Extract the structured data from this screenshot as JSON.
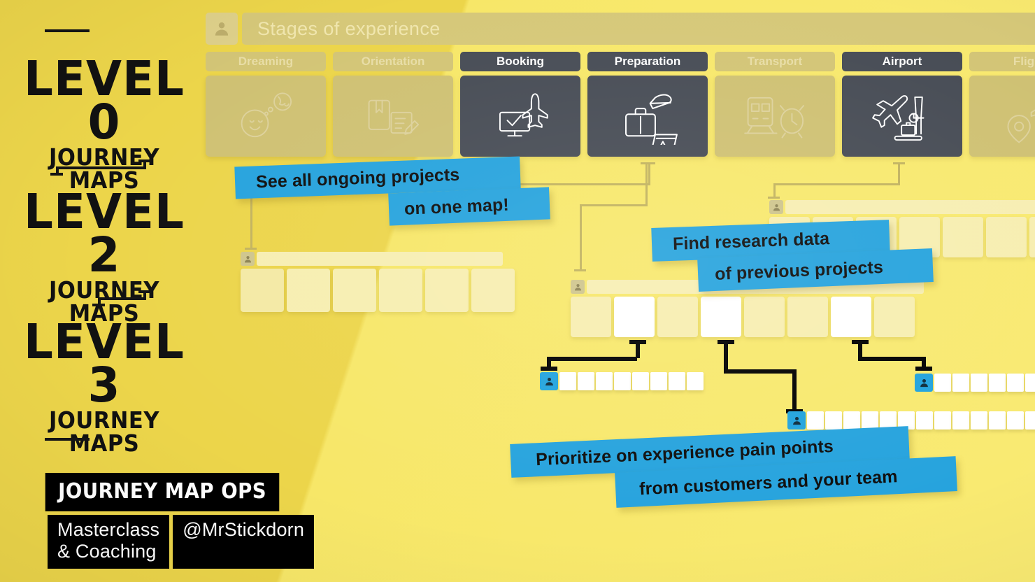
{
  "theme": {
    "bg_yellow_light": "#f9ea72",
    "bg_yellow_dark": "#ecd54a",
    "accent_blue": "#26a3dd",
    "dark_slate": "#474c55",
    "olive": "#c2b35e",
    "black": "#000000"
  },
  "left_panel": {
    "levels": [
      {
        "title": "LEVEL 0",
        "subtitle": "JOURNEY MAPS"
      },
      {
        "title": "LEVEL 2",
        "subtitle": "JOURNEY MAPS"
      },
      {
        "title": "LEVEL 3",
        "subtitle": "JOURNEY MAPS"
      }
    ],
    "badge": {
      "main": "JOURNEY MAP OPS",
      "sub_left": "Masterclass & Coaching",
      "sub_right": "@MrStickdorn"
    }
  },
  "level0_map": {
    "avatar_icon": "person-icon",
    "title": "Stages of experience",
    "stages": [
      {
        "label": "Dreaming",
        "state": "dim",
        "icon": "dreaming-icon"
      },
      {
        "label": "Orientation",
        "state": "dim",
        "icon": "research-icon"
      },
      {
        "label": "Booking",
        "state": "active",
        "icon": "booking-icon"
      },
      {
        "label": "Preparation",
        "state": "active",
        "icon": "packing-icon"
      },
      {
        "label": "Transport",
        "state": "dim",
        "icon": "transport-icon"
      },
      {
        "label": "Airport",
        "state": "active",
        "icon": "airport-icon"
      },
      {
        "label": "Flight",
        "state": "dim",
        "icon": "flight-icon"
      }
    ]
  },
  "level2_maps": [
    {
      "id": "booking-map",
      "avatar_icon": "person-icon",
      "cards": [
        "tint",
        "pale",
        "pale",
        "pale",
        "pale",
        "pale"
      ]
    },
    {
      "id": "preparation-map",
      "avatar_icon": "person-icon",
      "cards": [
        "pale",
        "white",
        "pale",
        "white",
        "pale",
        "pale",
        "white",
        "pale"
      ]
    },
    {
      "id": "airport-map",
      "avatar_icon": "person-icon",
      "cards": [
        "pale",
        "pale",
        "pale",
        "pale",
        "pale",
        "pale",
        "pale"
      ]
    }
  ],
  "level3_maps": [
    {
      "id": "l3-left",
      "avatar_icon": "person-icon",
      "card_count": 8
    },
    {
      "id": "l3-right",
      "avatar_icon": "person-icon",
      "card_count": 9
    },
    {
      "id": "l3-center",
      "avatar_icon": "person-icon",
      "card_count": 13
    }
  ],
  "callouts": [
    {
      "id": "callout-projects",
      "line1": "See all ongoing projects",
      "line2": "on one map!"
    },
    {
      "id": "callout-research",
      "line1": "Find research data",
      "line2": "of previous projects"
    },
    {
      "id": "callout-prioritize",
      "line1": "Prioritize on experience pain points",
      "line2": "from customers and your team"
    }
  ]
}
